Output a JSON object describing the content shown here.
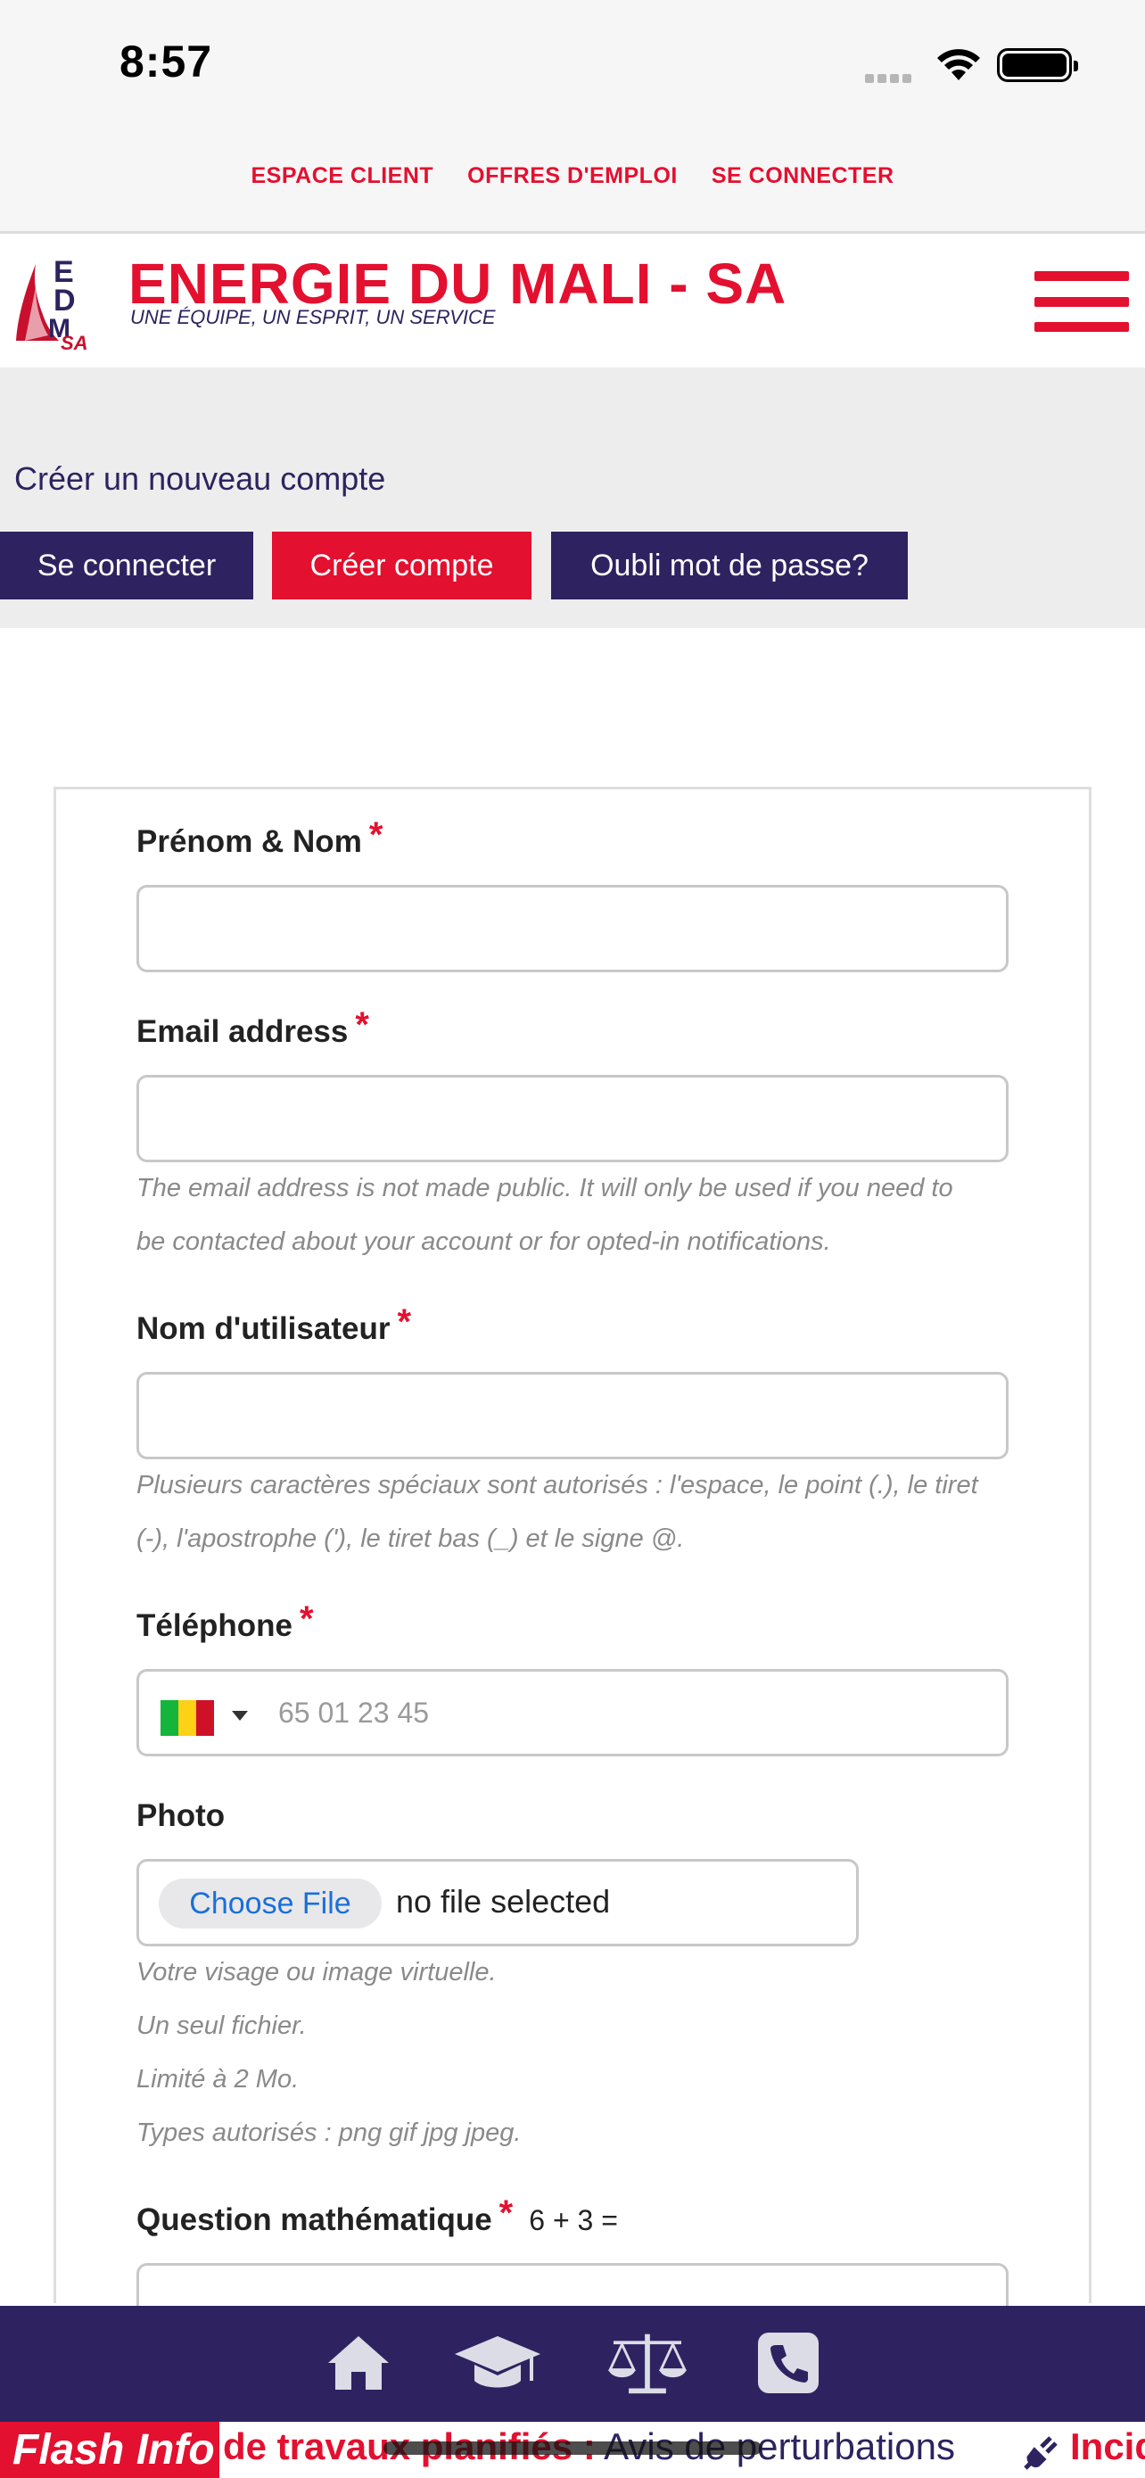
{
  "status_bar": {
    "time": "8:57"
  },
  "top_links": [
    "ESPACE CLIENT",
    "OFFRES D'EMPLOI",
    "SE CONNECTER"
  ],
  "header": {
    "logo_text": "EDM SA",
    "title": "ENERGIE DU MALI - SA",
    "tagline": "UNE ÉQUIPE, UN ESPRIT, UN SERVICE"
  },
  "account": {
    "heading": "Créer un nouveau compte",
    "tabs": [
      "Se connecter",
      "Créer compte",
      "Oubli mot de passe?"
    ]
  },
  "form": {
    "name_label": "Prénom & Nom",
    "email_label": "Email address",
    "email_help_1": "The email address is not made public. It will only be used if you need to",
    "email_help_2": "be contacted about your account or for opted-in notifications.",
    "username_label": "Nom d'utilisateur",
    "username_help_1": "Plusieurs caractères spéciaux sont autorisés : l'espace, le point (.), le tiret",
    "username_help_2": "(-), l'apostrophe ('), le tiret bas (_) et le signe @.",
    "phone_label": "Téléphone",
    "phone_placeholder": "65 01 23 45",
    "photo_label": "Photo",
    "choose_file": "Choose File",
    "no_file": "no file selected",
    "photo_help": [
      "Votre visage ou image virtuelle.",
      "Un seul fichier.",
      "Limité à 2 Mo.",
      "Types autorisés : png gif jpg jpeg."
    ],
    "math_label": "Question mathématique",
    "math_expression": "6 + 3 =",
    "required_mark": "*"
  },
  "bottom_nav": [
    "home-icon",
    "graduation-cap-icon",
    "balance-scale-icon",
    "phone-icon"
  ],
  "flash": {
    "label": "Flash Info",
    "bold_text": "de travaux planifiés :",
    "text": " Avis de perturbations",
    "next": "Incid"
  },
  "colors": {
    "brand_red": "#e3102f",
    "brand_navy": "#2e2360"
  }
}
